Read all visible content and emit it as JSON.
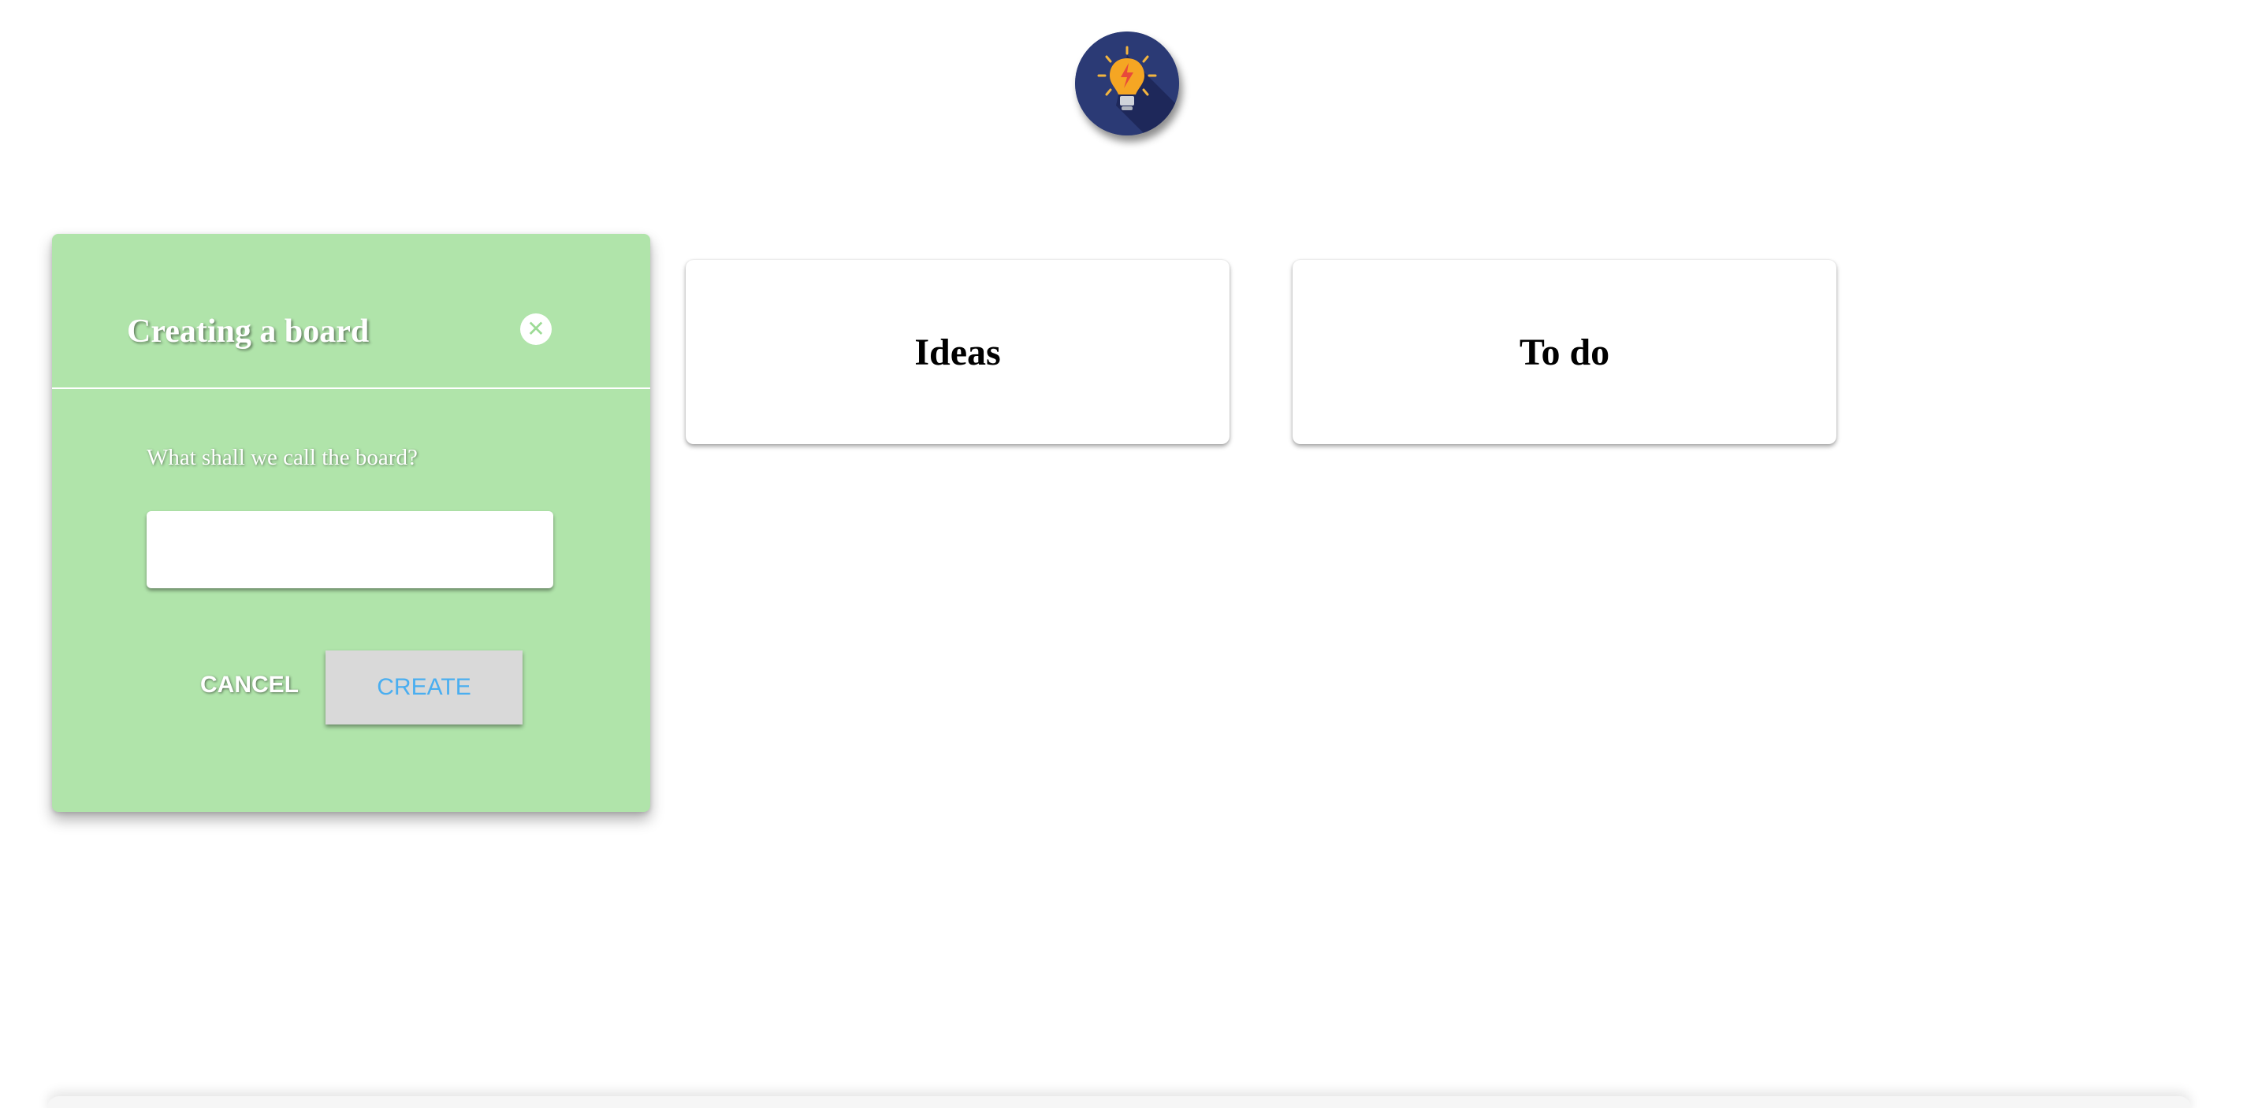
{
  "app": {
    "logo_icon": "lightbulb-logo-icon"
  },
  "boards": [
    {
      "title": "Ideas"
    },
    {
      "title": "To do"
    }
  ],
  "dialog": {
    "title": "Creating a board",
    "close_icon": "close-icon",
    "field_label": "What shall we call the board?",
    "input_value": "",
    "input_placeholder": "",
    "cancel_label": "CANCEL",
    "create_label": "CREATE",
    "background_color": "#b0e4aa",
    "create_text_color": "#4aaef0"
  }
}
